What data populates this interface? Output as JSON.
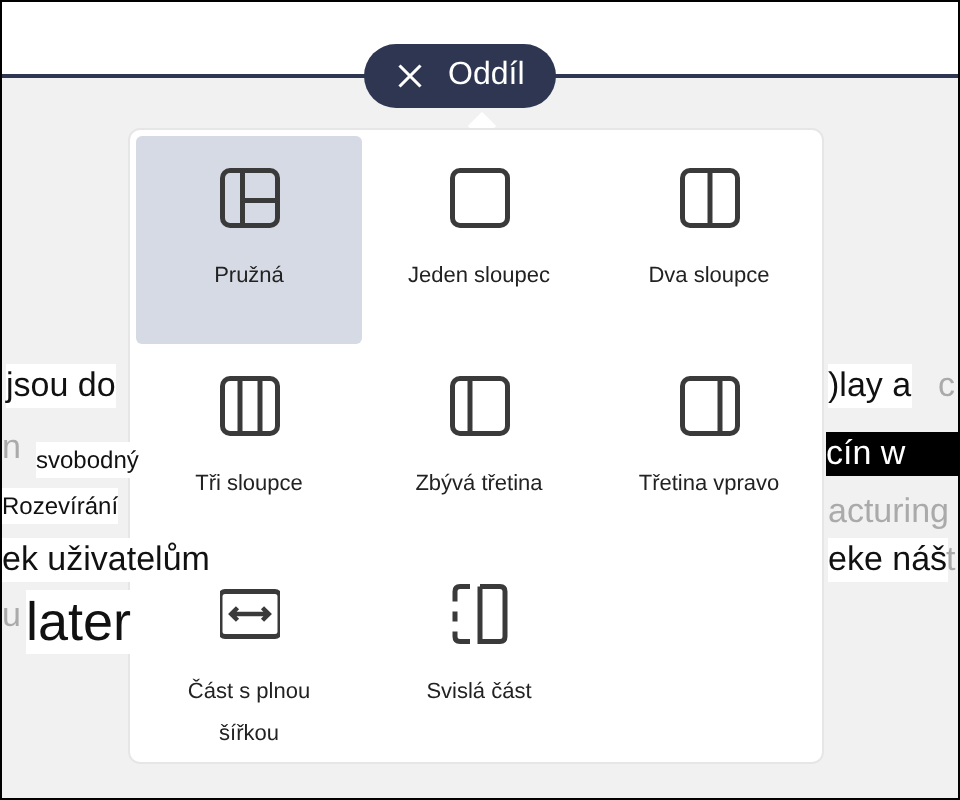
{
  "section_pill": {
    "label": "Oddíl"
  },
  "layouts": [
    {
      "label": "Pružná",
      "kind": "flexible",
      "selected": true
    },
    {
      "label": "Jeden sloupec",
      "kind": "one",
      "selected": false
    },
    {
      "label": "Dva sloupce",
      "kind": "two",
      "selected": false
    },
    {
      "label": "Tři sloupce",
      "kind": "three",
      "selected": false
    },
    {
      "label": "Zbývá třetina",
      "kind": "leftthird",
      "selected": false
    },
    {
      "label": "Třetina vpravo",
      "kind": "rightthird",
      "selected": false
    },
    {
      "label": "Část s plnou šířkou",
      "kind": "fullwidth",
      "selected": false
    },
    {
      "label": "Svislá část",
      "kind": "vertical",
      "selected": false
    }
  ],
  "background_fragments": [
    {
      "text": "jsou do",
      "kind": "normal"
    },
    {
      "text": "n",
      "kind": "faded"
    },
    {
      "text": "svobodný",
      "kind": "small"
    },
    {
      "text": "Rozevírání",
      "kind": "small"
    },
    {
      "text": "ek uživatelům",
      "kind": "normal"
    },
    {
      "text": "u",
      "kind": "faded"
    },
    {
      "text": "later",
      "kind": "large"
    },
    {
      "text": ")lay a",
      "kind": "normal"
    },
    {
      "text": "c",
      "kind": "faded"
    },
    {
      "text": "cín w",
      "kind": "inverted"
    },
    {
      "text": "acturing",
      "kind": "faded"
    },
    {
      "text": "eke náš",
      "kind": "normal"
    },
    {
      "text": "t",
      "kind": "faded"
    }
  ]
}
